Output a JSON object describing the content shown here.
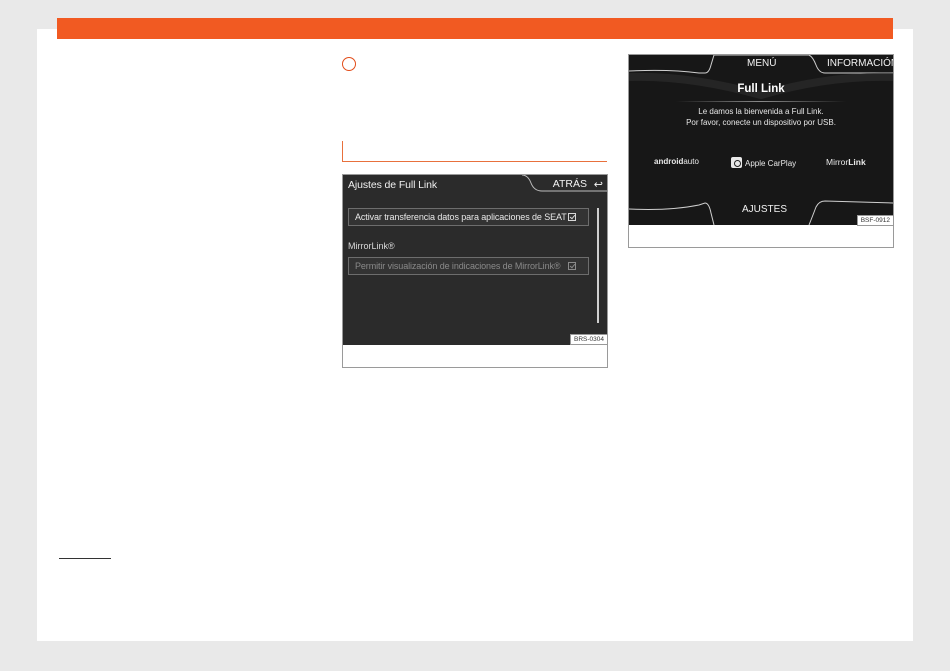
{
  "figure1": {
    "title": "Ajustes de Full Link",
    "back_button": "ATRÁS",
    "back_icon": "return-arrow-icon",
    "rows": [
      {
        "label": "Activar transferencia datos para aplicaciones de SEAT",
        "checked": true,
        "enabled": true
      },
      {
        "label": "Permitir visualización de indicaciones de MirrorLink®",
        "checked": true,
        "enabled": false
      }
    ],
    "section_label": "MirrorLink®",
    "code": "BRS-0304"
  },
  "figure2": {
    "menu_tab": "MENÚ",
    "info_tab": "INFORMACIÓN",
    "title": "Full Link",
    "message_line1": "Le damos la bienvenida a Full Link.",
    "message_line2": "Por favor, conecte un dispositivo por USB.",
    "logos": {
      "android_prefix": "android",
      "android_suffix": "auto",
      "carplay": "Apple CarPlay",
      "mirror_prefix": "Mirror",
      "mirror_suffix": "Link"
    },
    "settings_tab": "AJUSTES",
    "code": "BSF-0912"
  },
  "colors": {
    "accent": "#f15a22",
    "screen_dark": "#2b2b2b",
    "screen_black": "#171717"
  }
}
